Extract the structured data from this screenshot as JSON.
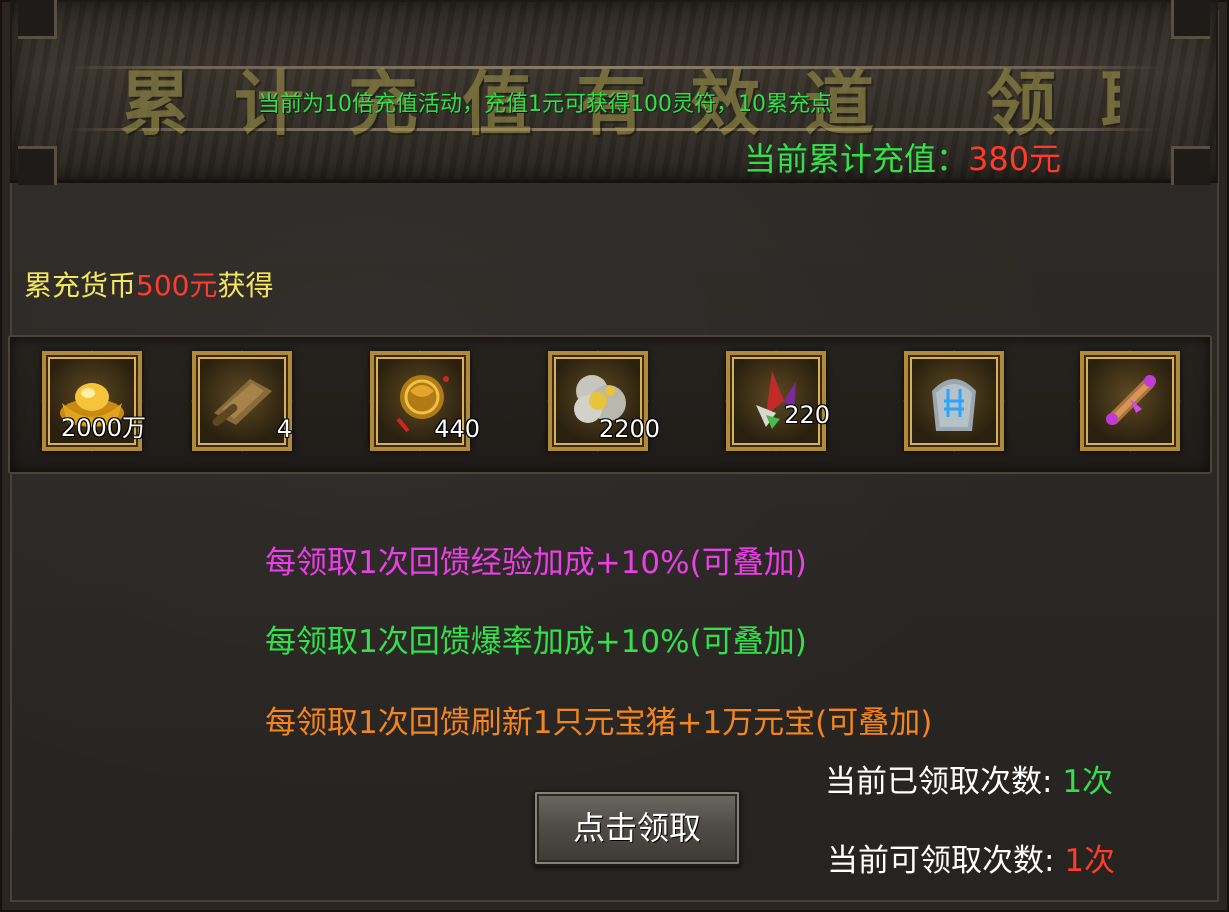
{
  "banner": {
    "title": "累计充值有效道 领取豪华大礼",
    "notice": "当前为10倍充值活动，充值1元可获得100灵符，10累充点",
    "total_label": "当前累计充值：",
    "total_value": "380元"
  },
  "threshold": {
    "prefix": "累充货币",
    "amount": "500元",
    "suffix": "获得"
  },
  "rewards": [
    {
      "icon": "gold-ingot-icon",
      "qty": "2000万"
    },
    {
      "icon": "scroll-icon",
      "qty": "4"
    },
    {
      "icon": "gold-amulet-icon",
      "qty": "440"
    },
    {
      "icon": "silver-ore-icon",
      "qty": "2200"
    },
    {
      "icon": "crystal-shard-icon",
      "qty": "220"
    },
    {
      "icon": "rune-stone-icon",
      "qty": ""
    },
    {
      "icon": "purple-scroll-icon",
      "qty": ""
    }
  ],
  "bonuses": {
    "exp": "每领取1次回馈经验加成+10%(可叠加)",
    "drop": "每领取1次回馈爆率加成+10%(可叠加)",
    "pig": "每领取1次回馈刷新1只元宝猪+1万元宝(可叠加)"
  },
  "counts": {
    "claimed_label": "当前已领取次数: ",
    "claimed_value": "1次",
    "available_label": "当前可领取次数: ",
    "available_value": "1次"
  },
  "button": {
    "claim_label": "点击领取"
  },
  "colors": {
    "green": "#33e04a",
    "red": "#ff3b2c",
    "yellow": "#f4e65c",
    "magenta": "#ea3ee6",
    "orange": "#f2851e"
  }
}
